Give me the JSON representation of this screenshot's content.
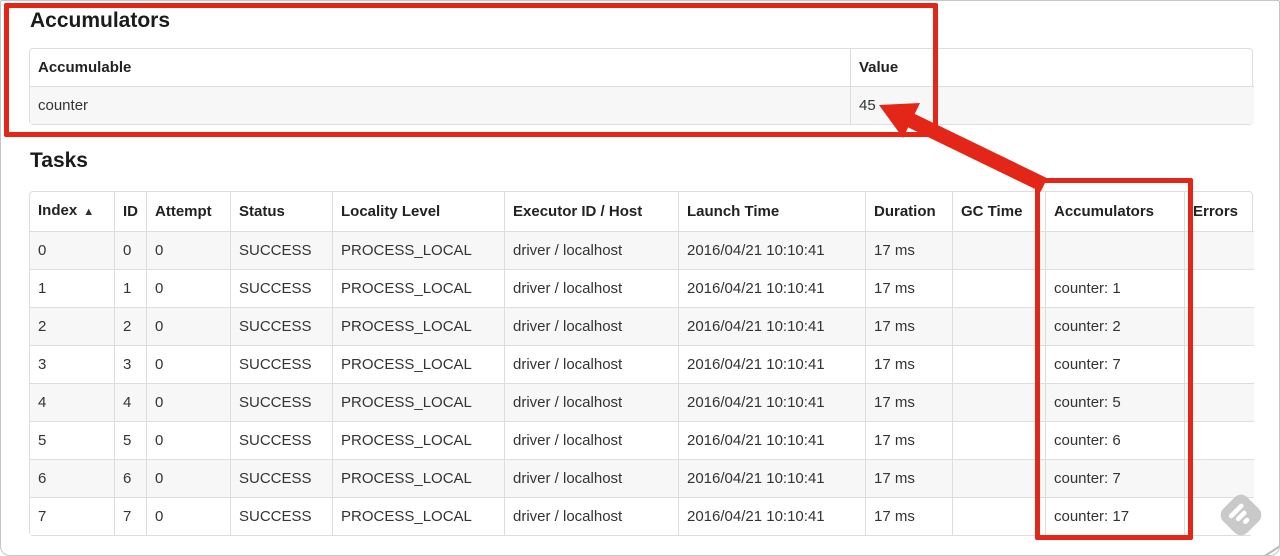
{
  "page": {
    "accumulators": {
      "title": "Accumulators",
      "headers": [
        "Accumulable",
        "Value"
      ],
      "row": {
        "name": "counter",
        "value": "45"
      }
    },
    "tasks": {
      "title": "Tasks",
      "sort_icon": "▲",
      "headers": [
        "Index",
        "ID",
        "Attempt",
        "Status",
        "Locality Level",
        "Executor ID / Host",
        "Launch Time",
        "Duration",
        "GC Time",
        "Accumulators",
        "Errors"
      ],
      "columns": [
        "index",
        "id",
        "attempt",
        "status",
        "locality_level",
        "executor_id_host",
        "launch_time",
        "duration",
        "gc_time",
        "accumulators",
        "errors"
      ],
      "rows": [
        {
          "index": "0",
          "id": "0",
          "attempt": "0",
          "status": "SUCCESS",
          "locality_level": "PROCESS_LOCAL",
          "executor_id_host": "driver / localhost",
          "launch_time": "2016/04/21 10:10:41",
          "duration": "17 ms",
          "gc_time": "",
          "accumulators": "",
          "errors": ""
        },
        {
          "index": "1",
          "id": "1",
          "attempt": "0",
          "status": "SUCCESS",
          "locality_level": "PROCESS_LOCAL",
          "executor_id_host": "driver / localhost",
          "launch_time": "2016/04/21 10:10:41",
          "duration": "17 ms",
          "gc_time": "",
          "accumulators": "counter: 1",
          "errors": ""
        },
        {
          "index": "2",
          "id": "2",
          "attempt": "0",
          "status": "SUCCESS",
          "locality_level": "PROCESS_LOCAL",
          "executor_id_host": "driver / localhost",
          "launch_time": "2016/04/21 10:10:41",
          "duration": "17 ms",
          "gc_time": "",
          "accumulators": "counter: 2",
          "errors": ""
        },
        {
          "index": "3",
          "id": "3",
          "attempt": "0",
          "status": "SUCCESS",
          "locality_level": "PROCESS_LOCAL",
          "executor_id_host": "driver / localhost",
          "launch_time": "2016/04/21 10:10:41",
          "duration": "17 ms",
          "gc_time": "",
          "accumulators": "counter: 7",
          "errors": ""
        },
        {
          "index": "4",
          "id": "4",
          "attempt": "0",
          "status": "SUCCESS",
          "locality_level": "PROCESS_LOCAL",
          "executor_id_host": "driver / localhost",
          "launch_time": "2016/04/21 10:10:41",
          "duration": "17 ms",
          "gc_time": "",
          "accumulators": "counter: 5",
          "errors": ""
        },
        {
          "index": "5",
          "id": "5",
          "attempt": "0",
          "status": "SUCCESS",
          "locality_level": "PROCESS_LOCAL",
          "executor_id_host": "driver / localhost",
          "launch_time": "2016/04/21 10:10:41",
          "duration": "17 ms",
          "gc_time": "",
          "accumulators": "counter: 6",
          "errors": ""
        },
        {
          "index": "6",
          "id": "6",
          "attempt": "0",
          "status": "SUCCESS",
          "locality_level": "PROCESS_LOCAL",
          "executor_id_host": "driver / localhost",
          "launch_time": "2016/04/21 10:10:41",
          "duration": "17 ms",
          "gc_time": "",
          "accumulators": "counter: 7",
          "errors": ""
        },
        {
          "index": "7",
          "id": "7",
          "attempt": "0",
          "status": "SUCCESS",
          "locality_level": "PROCESS_LOCAL",
          "executor_id_host": "driver / localhost",
          "launch_time": "2016/04/21 10:10:41",
          "duration": "17 ms",
          "gc_time": "",
          "accumulators": "counter: 17",
          "errors": ""
        }
      ]
    },
    "annotation": {
      "color": "#e42619"
    },
    "icons": {
      "feedly_color": "#c9c9c9"
    }
  }
}
